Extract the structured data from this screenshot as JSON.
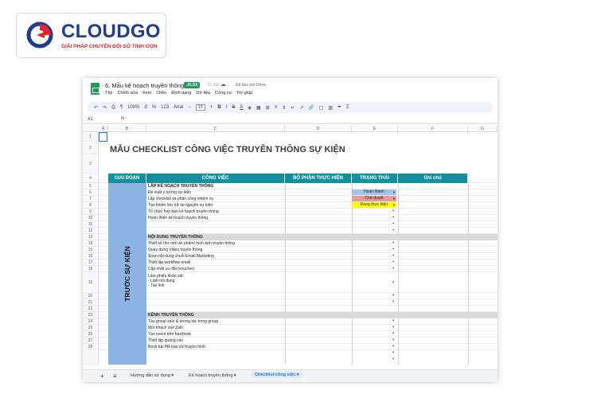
{
  "brand": {
    "name": "CLOUDGO",
    "tagline": "GIẢI PHÁP CHUYỂN ĐỔI SỐ TINH GỌN"
  },
  "doc": {
    "title": "6. Mẫu kế hoạch truyền thông",
    "badge": ".XLSX",
    "saved": "Đã lưu vào Drive",
    "menu": [
      "Tệp",
      "Chỉnh sửa",
      "Xem",
      "Chèn",
      "Định dạng",
      "Dữ liệu",
      "Công cụ",
      "Trợ giúp"
    ]
  },
  "toolbar": {
    "zoom": "100%",
    "currency": "đ",
    "percent": "%",
    "format_number": "123",
    "font": "Arial",
    "font_size": "15",
    "bold": "B",
    "italic": "I",
    "strike": "S",
    "text_color": "A"
  },
  "formula": {
    "cell_ref": "A1",
    "fx": "fx"
  },
  "columns": [
    "A",
    "B",
    "C",
    "D",
    "E",
    "F",
    "G"
  ],
  "rows": [
    "1",
    "2",
    "3",
    "4",
    "5",
    "6",
    "7",
    "8",
    "9",
    "10",
    "11",
    "12",
    "13",
    "14",
    "15",
    "16",
    "17",
    "18",
    "19",
    "20",
    "21",
    "22",
    "23",
    "24",
    "25",
    "26",
    "27",
    "28"
  ],
  "sheet": {
    "heading": "MẪU CHECKLIST CÔNG VIỆC TRUYỀN THÔNG SỰ KIỆN",
    "headers": {
      "phase": "GIAI ĐOẠN",
      "task": "CÔNG VIỆC",
      "dept": "BỘ PHẬN THỰC HIỆN",
      "status": "TRẠNG THÁI",
      "note": "Ghi chú"
    },
    "phase_label": "TRƯỚC SỰ KIỆN",
    "sections": [
      "LẬP KẾ HOẠCH TRUYỀN THÔNG",
      "NỘI DUNG TRUYỀN THÔNG",
      "KÊNH TRUYỀN THÔNG"
    ],
    "tasks_plan": [
      "Đề xuất ý tưởng sự kiện",
      "Lập checklist và phân công nhiệm vụ",
      "Tạo folder lưu trữ tài nguyên sự kiện",
      "Tổ chức họp bàn kế hoạch truyền thông",
      "Hoàn thiện kế hoạch truyền thông"
    ],
    "tasks_content": [
      "Thiết kế thư mời ấn phẩm/ hình ảnh truyền thông",
      "Quay dựng Video truyền thông",
      "Soạn nội dung chuỗi Email Marketing",
      "Thiết lập workflow email",
      "Cập nhật ưu đãi (voucher)",
      "Làm phiếu khảo sát:\n- Làm nội dung\n- Tạo link"
    ],
    "tasks_channel": [
      "Tạo group zalo & tương tác trong group",
      "Mời khách vào Zalo",
      "Tạo event trên facebook",
      "Thiết lập quảng cáo",
      "Book bài PR báo chí truyền hình"
    ],
    "statuses": [
      {
        "label": "Hoàn thành",
        "color": "#9fc5e8"
      },
      {
        "label": "Chờ duyệt",
        "color": "#ea9999"
      },
      {
        "label": "Đang thực hiện",
        "color": "#ffff00"
      }
    ]
  },
  "tabs": [
    "Hướng dẫn sử dụng",
    "Kế hoạch truyền thông",
    "Checklist công việc"
  ],
  "colors": {
    "header_teal": "#12909e",
    "phase_blue": "#8db4e2",
    "brand_blue": "#1f3d8f",
    "brand_red": "#e1272d"
  }
}
